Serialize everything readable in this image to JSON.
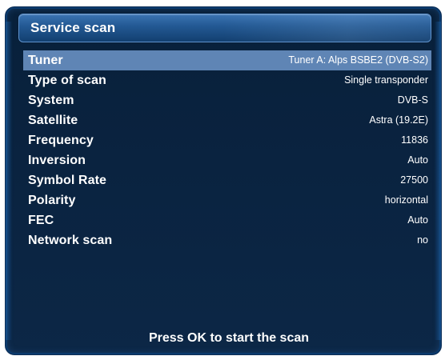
{
  "window": {
    "title": "Service scan",
    "footer": "Press OK to start the scan"
  },
  "settings": [
    {
      "label": "Tuner",
      "value": "Tuner A: Alps BSBE2 (DVB-S2)",
      "selected": true
    },
    {
      "label": "Type of scan",
      "value": "Single transponder"
    },
    {
      "label": "System",
      "value": "DVB-S"
    },
    {
      "label": "Satellite",
      "value": "Astra (19.2E)"
    },
    {
      "label": "Frequency",
      "value": "11836"
    },
    {
      "label": "Inversion",
      "value": "Auto"
    },
    {
      "label": "Symbol Rate",
      "value": "27500"
    },
    {
      "label": "Polarity",
      "value": "horizontal"
    },
    {
      "label": "FEC",
      "value": "Auto"
    },
    {
      "label": "Network scan",
      "value": "no"
    }
  ],
  "colors": {
    "background": "#0a2340",
    "selection": "#5f85b5",
    "title_bar": "#245a95",
    "text": "#ffffff"
  }
}
